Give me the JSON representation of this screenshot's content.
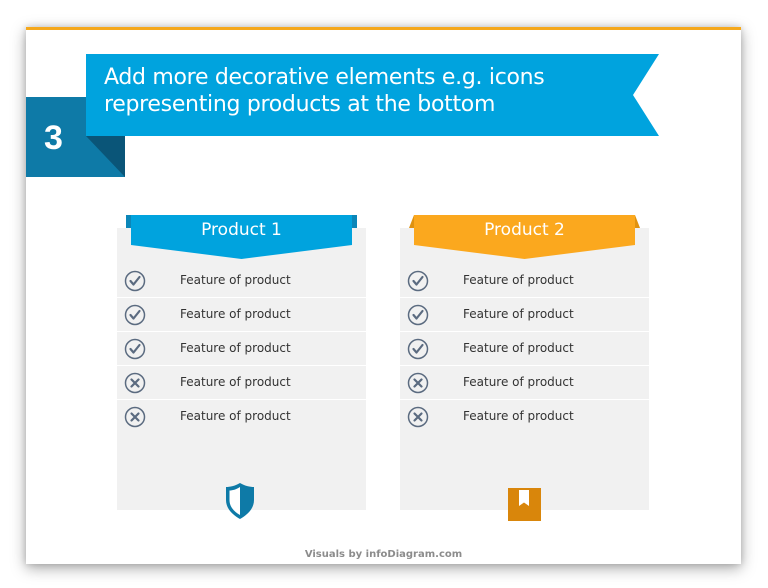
{
  "slide": {
    "step_number": "3",
    "headline_line1": "Add more decorative elements e.g. icons",
    "headline_line2": "representing products at the bottom",
    "footer": "Visuals by infoDiagram.com"
  },
  "colors": {
    "accent_orange": "#f5a81c",
    "ribbon_blue": "#00a3de",
    "number_box_blue": "#0e7aa7",
    "fold_navy": "#0a5578",
    "product2_orange": "#fba81e",
    "card_bg": "#f1f1f1",
    "feature_icon": "#5b6b80",
    "shield_blue": "#0e7aa7",
    "box_orange": "#d9860b"
  },
  "products": [
    {
      "title": "Product 1",
      "bottom_icon": "shield-icon",
      "features": [
        {
          "label": "Feature of product",
          "status": "check"
        },
        {
          "label": "Feature of product",
          "status": "check"
        },
        {
          "label": "Feature of product",
          "status": "check"
        },
        {
          "label": "Feature of product",
          "status": "cross"
        },
        {
          "label": "Feature of product",
          "status": "cross"
        }
      ]
    },
    {
      "title": "Product 2",
      "bottom_icon": "box-icon",
      "features": [
        {
          "label": "Feature of product",
          "status": "check"
        },
        {
          "label": "Feature of product",
          "status": "check"
        },
        {
          "label": "Feature of product",
          "status": "check"
        },
        {
          "label": "Feature of product",
          "status": "cross"
        },
        {
          "label": "Feature of product",
          "status": "cross"
        }
      ]
    }
  ]
}
